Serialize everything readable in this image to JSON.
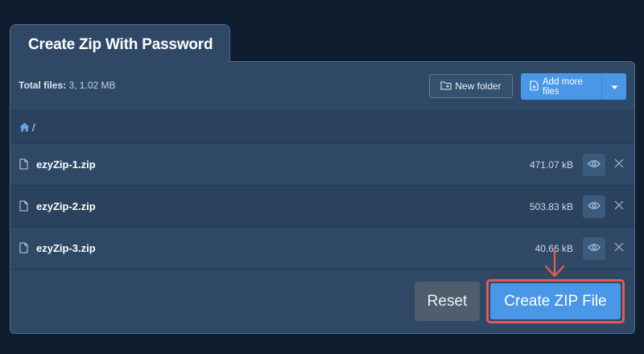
{
  "tab": {
    "title": "Create Zip With Password"
  },
  "toolbar": {
    "total_label": "Total files:",
    "total_value": "3, 1.02 MB",
    "new_folder_label": "New folder",
    "add_files_label": "Add more files"
  },
  "breadcrumb": {
    "separator": "/"
  },
  "files": [
    {
      "name": "ezyZip-1.zip",
      "size": "471.07 kB"
    },
    {
      "name": "ezyZip-2.zip",
      "size": "503.83 kB"
    },
    {
      "name": "ezyZip-3.zip",
      "size": "40.66 kB"
    }
  ],
  "actions": {
    "reset_label": "Reset",
    "create_label": "Create ZIP File"
  },
  "icons": {
    "home": "home-icon",
    "file": "file-icon",
    "eye": "eye-icon",
    "close": "close-icon",
    "folder_add": "folder-add-icon",
    "file_add": "file-add-icon",
    "caret": "caret-down-icon",
    "arrow": "arrow-down-icon"
  },
  "colors": {
    "background": "#0f1d2e",
    "panel": "#2e4866",
    "accent": "#4a97e8",
    "highlight": "#e05b52",
    "reset": "#4f5d6c"
  }
}
